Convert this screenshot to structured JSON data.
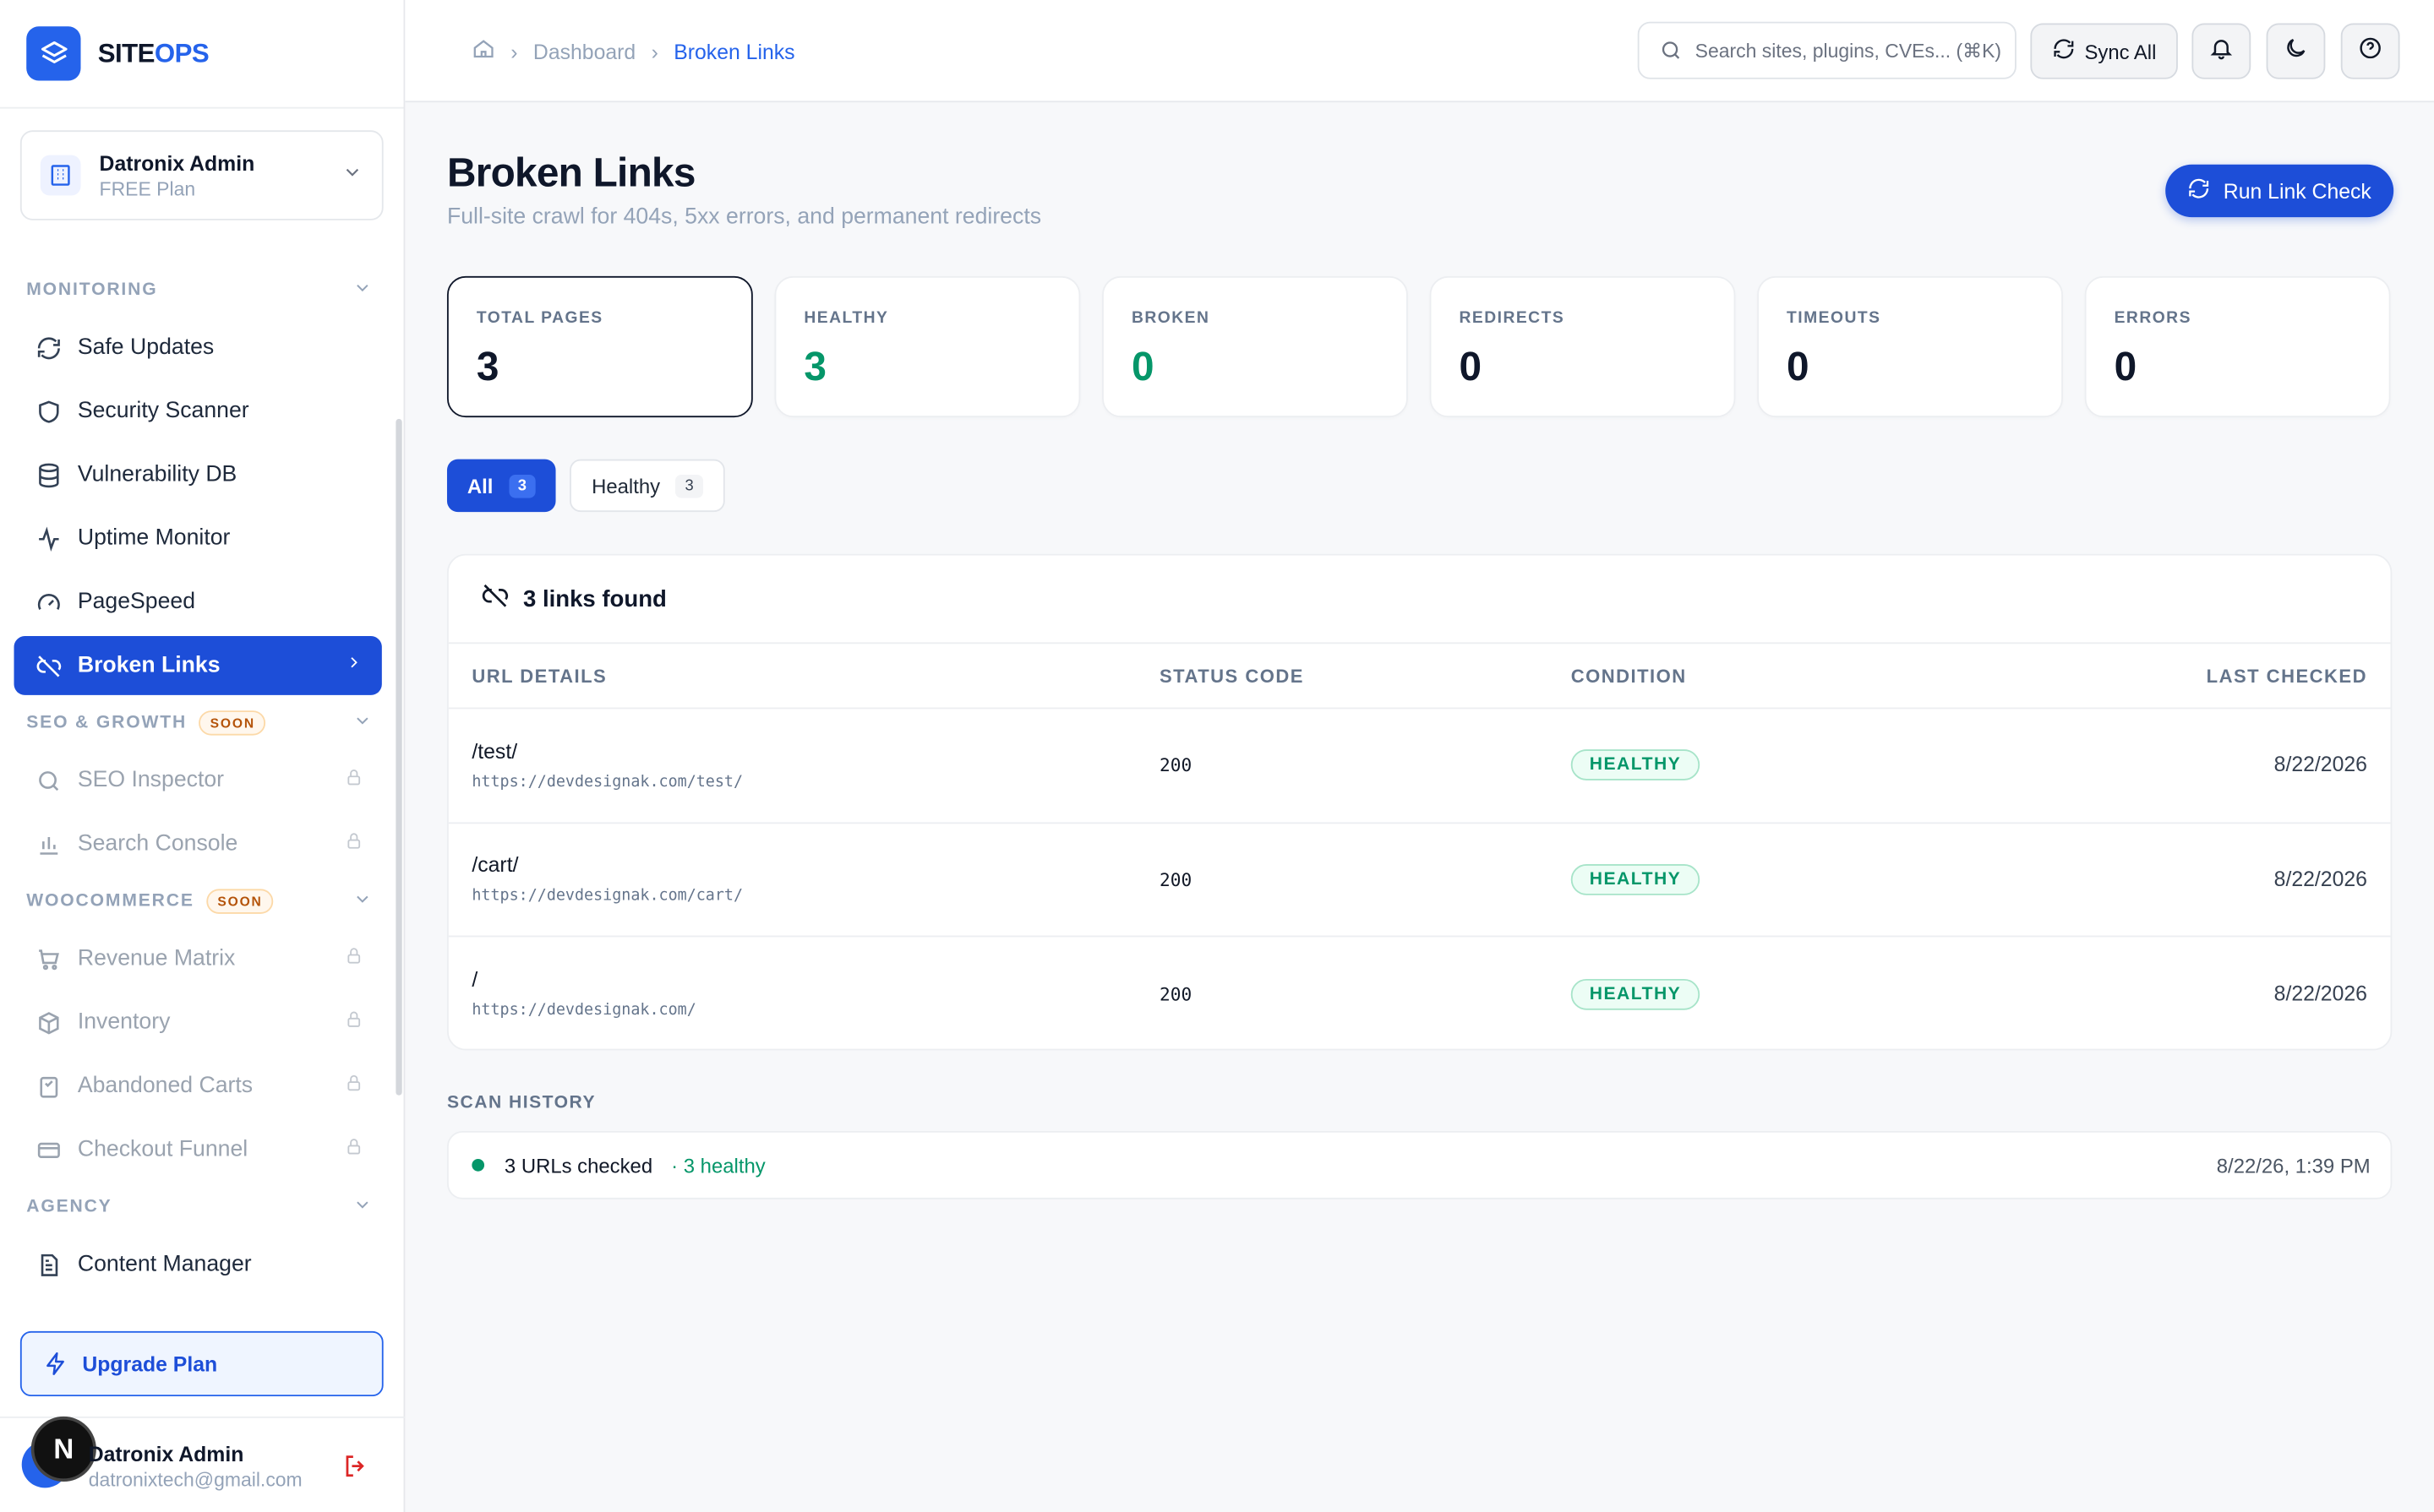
{
  "brand": {
    "name_a": "SITE",
    "name_b": "OPS"
  },
  "workspace": {
    "name": "Datronix Admin",
    "plan": "FREE Plan"
  },
  "sidebar": {
    "monitoring": {
      "title": "MONITORING",
      "items": [
        "Safe Updates",
        "Security Scanner",
        "Vulnerability DB",
        "Uptime Monitor",
        "PageSpeed",
        "Broken Links"
      ]
    },
    "seo": {
      "title": "SEO & GROWTH",
      "badge": "SOON",
      "items": [
        "SEO Inspector",
        "Search Console"
      ]
    },
    "woo": {
      "title": "WOOCOMMERCE",
      "badge": "SOON",
      "items": [
        "Revenue Matrix",
        "Inventory",
        "Abandoned Carts",
        "Checkout Funnel"
      ]
    },
    "agency": {
      "title": "AGENCY",
      "items": [
        "Content Manager"
      ]
    },
    "upgrade": "Upgrade Plan"
  },
  "user": {
    "initial": "N",
    "name": "Datronix Admin",
    "email": "datronixtech@gmail.com"
  },
  "topbar": {
    "crumbs": [
      "Dashboard",
      "Broken Links"
    ],
    "search_placeholder": "Search sites, plugins, CVEs... (⌘K)",
    "sync": "Sync All"
  },
  "page": {
    "title": "Broken Links",
    "subtitle": "Full-site crawl for 404s, 5xx errors, and permanent redirects",
    "run_button": "Run Link Check"
  },
  "stats": [
    {
      "label": "TOTAL PAGES",
      "value": "3"
    },
    {
      "label": "HEALTHY",
      "value": "3"
    },
    {
      "label": "BROKEN",
      "value": "0"
    },
    {
      "label": "REDIRECTS",
      "value": "0"
    },
    {
      "label": "TIMEOUTS",
      "value": "0"
    },
    {
      "label": "ERRORS",
      "value": "0"
    }
  ],
  "filters": [
    {
      "label": "All",
      "count": "3"
    },
    {
      "label": "Healthy",
      "count": "3"
    }
  ],
  "table": {
    "heading": "3 links found",
    "columns": [
      "URL DETAILS",
      "STATUS CODE",
      "CONDITION",
      "LAST CHECKED"
    ],
    "rows": [
      {
        "path": "/test/",
        "url": "https://devdesignak.com/test/",
        "code": "200",
        "condition": "HEALTHY",
        "date": "8/22/2026"
      },
      {
        "path": "/cart/",
        "url": "https://devdesignak.com/cart/",
        "code": "200",
        "condition": "HEALTHY",
        "date": "8/22/2026"
      },
      {
        "path": "/",
        "url": "https://devdesignak.com/",
        "code": "200",
        "condition": "HEALTHY",
        "date": "8/22/2026"
      }
    ]
  },
  "history": {
    "title": "SCAN HISTORY",
    "checked": "3 URLs checked",
    "healthy": "· 3 healthy",
    "time": "8/22/26, 1:39 PM"
  },
  "colors": {
    "accent": "#1d4ed8",
    "success": "#059669",
    "muted": "#94a3b8"
  }
}
